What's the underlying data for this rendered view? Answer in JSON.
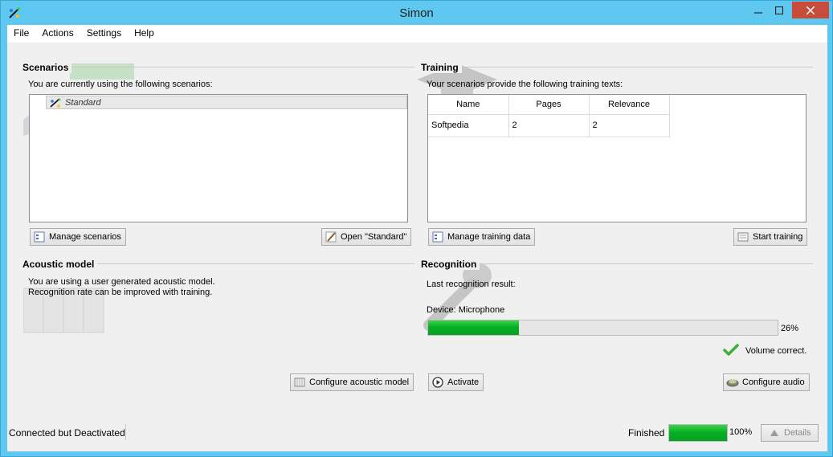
{
  "window": {
    "title": "Simon"
  },
  "menu": [
    "File",
    "Actions",
    "Settings",
    "Help"
  ],
  "scenarios": {
    "title": "Scenarios",
    "description": "You are currently using the following scenarios:",
    "items": [
      "Standard"
    ],
    "manage_button": "Manage scenarios",
    "open_button": "Open \"Standard\""
  },
  "training": {
    "title": "Training",
    "description": "Your scenarios provide the following training texts:",
    "columns": [
      "Name",
      "Pages",
      "Relevance"
    ],
    "rows": [
      [
        "Softpedia",
        "2",
        "2"
      ]
    ],
    "manage_button": "Manage training data",
    "start_button": "Start training"
  },
  "acoustic": {
    "title": "Acoustic model",
    "line1": "You are using a user generated acoustic model.",
    "line2": "Recognition rate can be improved with training.",
    "configure_button": "Configure acoustic model"
  },
  "recognition": {
    "title": "Recognition",
    "last_result": "Last recognition result:",
    "device": "Device: Microphone",
    "level_percent": 26,
    "level_label": "26%",
    "volume_status": "Volume correct.",
    "activate_button": "Activate",
    "configure_audio_button": "Configure audio"
  },
  "status": {
    "connection": "Connected but Deactivated",
    "task": "Finished",
    "task_percent": 100,
    "task_label": "100%",
    "details_button": "Details"
  },
  "colors": {
    "progress": "#06b025",
    "titlebar": "#5ec8f0",
    "close": "#c74c3c"
  }
}
